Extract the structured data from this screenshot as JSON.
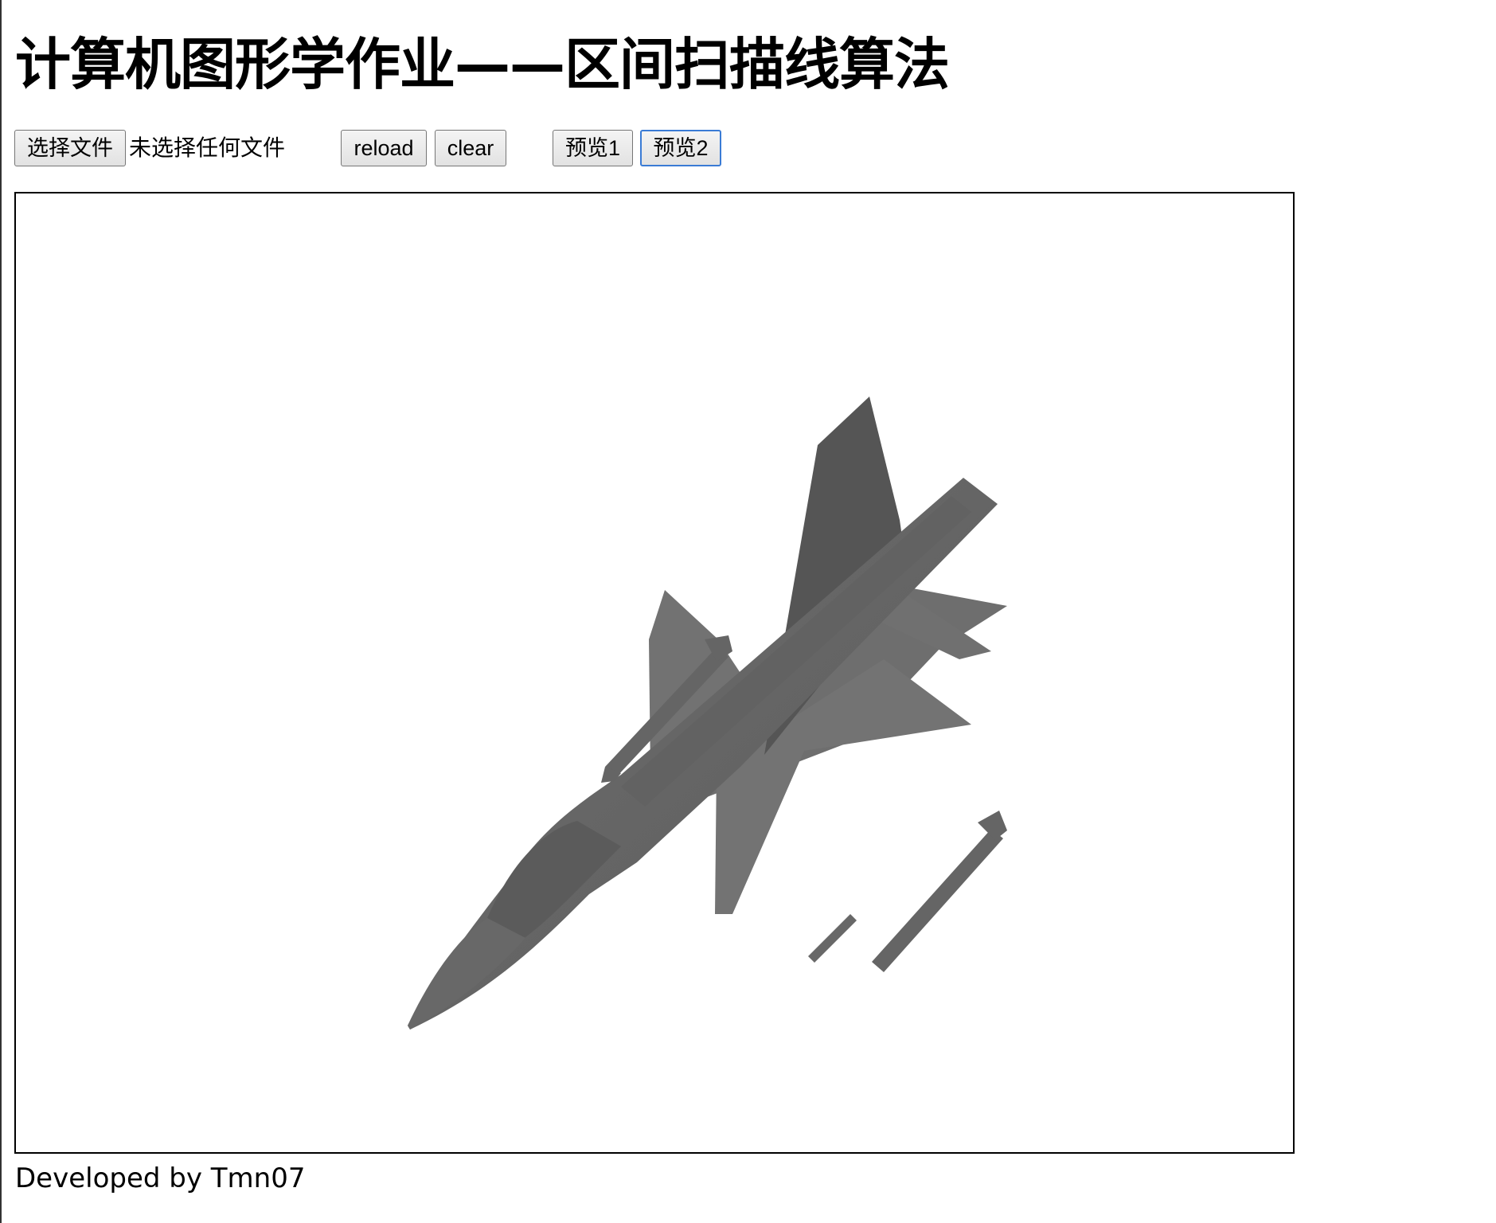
{
  "page": {
    "title": "计算机图形学作业——区间扫描线算法",
    "footer": "Developed by Tmn07"
  },
  "toolbar": {
    "file_button_label": "选择文件",
    "file_status": "未选择任何文件",
    "reload_label": "reload",
    "clear_label": "clear",
    "preview1_label": "预览1",
    "preview2_label": "预览2",
    "focused_button": "预览2"
  },
  "canvas": {
    "content": "rendered-fighter-jet-model",
    "fill_color": "#6f6f6f",
    "background_color": "#ffffff",
    "border_color": "#000000"
  },
  "colors": {
    "text": "#000000",
    "focus_ring": "#3a7bd5",
    "button_bg": "#e9e9e9"
  }
}
